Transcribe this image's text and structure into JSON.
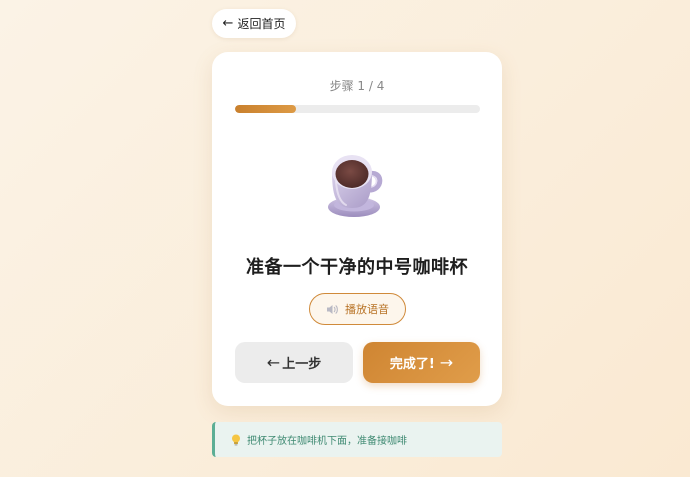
{
  "nav": {
    "back_arrow": "←",
    "back_label": "返回首页"
  },
  "step": {
    "label": "步骤 1 / 4",
    "current": 1,
    "total": 4,
    "progress_fraction": 0.25
  },
  "illustration": {
    "icon": "coffee-cup-icon"
  },
  "instruction": "准备一个干净的中号咖啡杯",
  "voice": {
    "icon": "speaker-icon",
    "label": "播放语音"
  },
  "buttons": {
    "prev_arrow": "←",
    "prev_label": "上一步",
    "next_label": "完成了!",
    "next_arrow": "→"
  },
  "tip": {
    "icon": "lightbulb-icon",
    "text": "把杯子放在咖啡机下面，准备接咖啡"
  },
  "colors": {
    "accent": "#d08a3a",
    "tip_accent": "#5cae95",
    "background": "#fbf0df"
  }
}
